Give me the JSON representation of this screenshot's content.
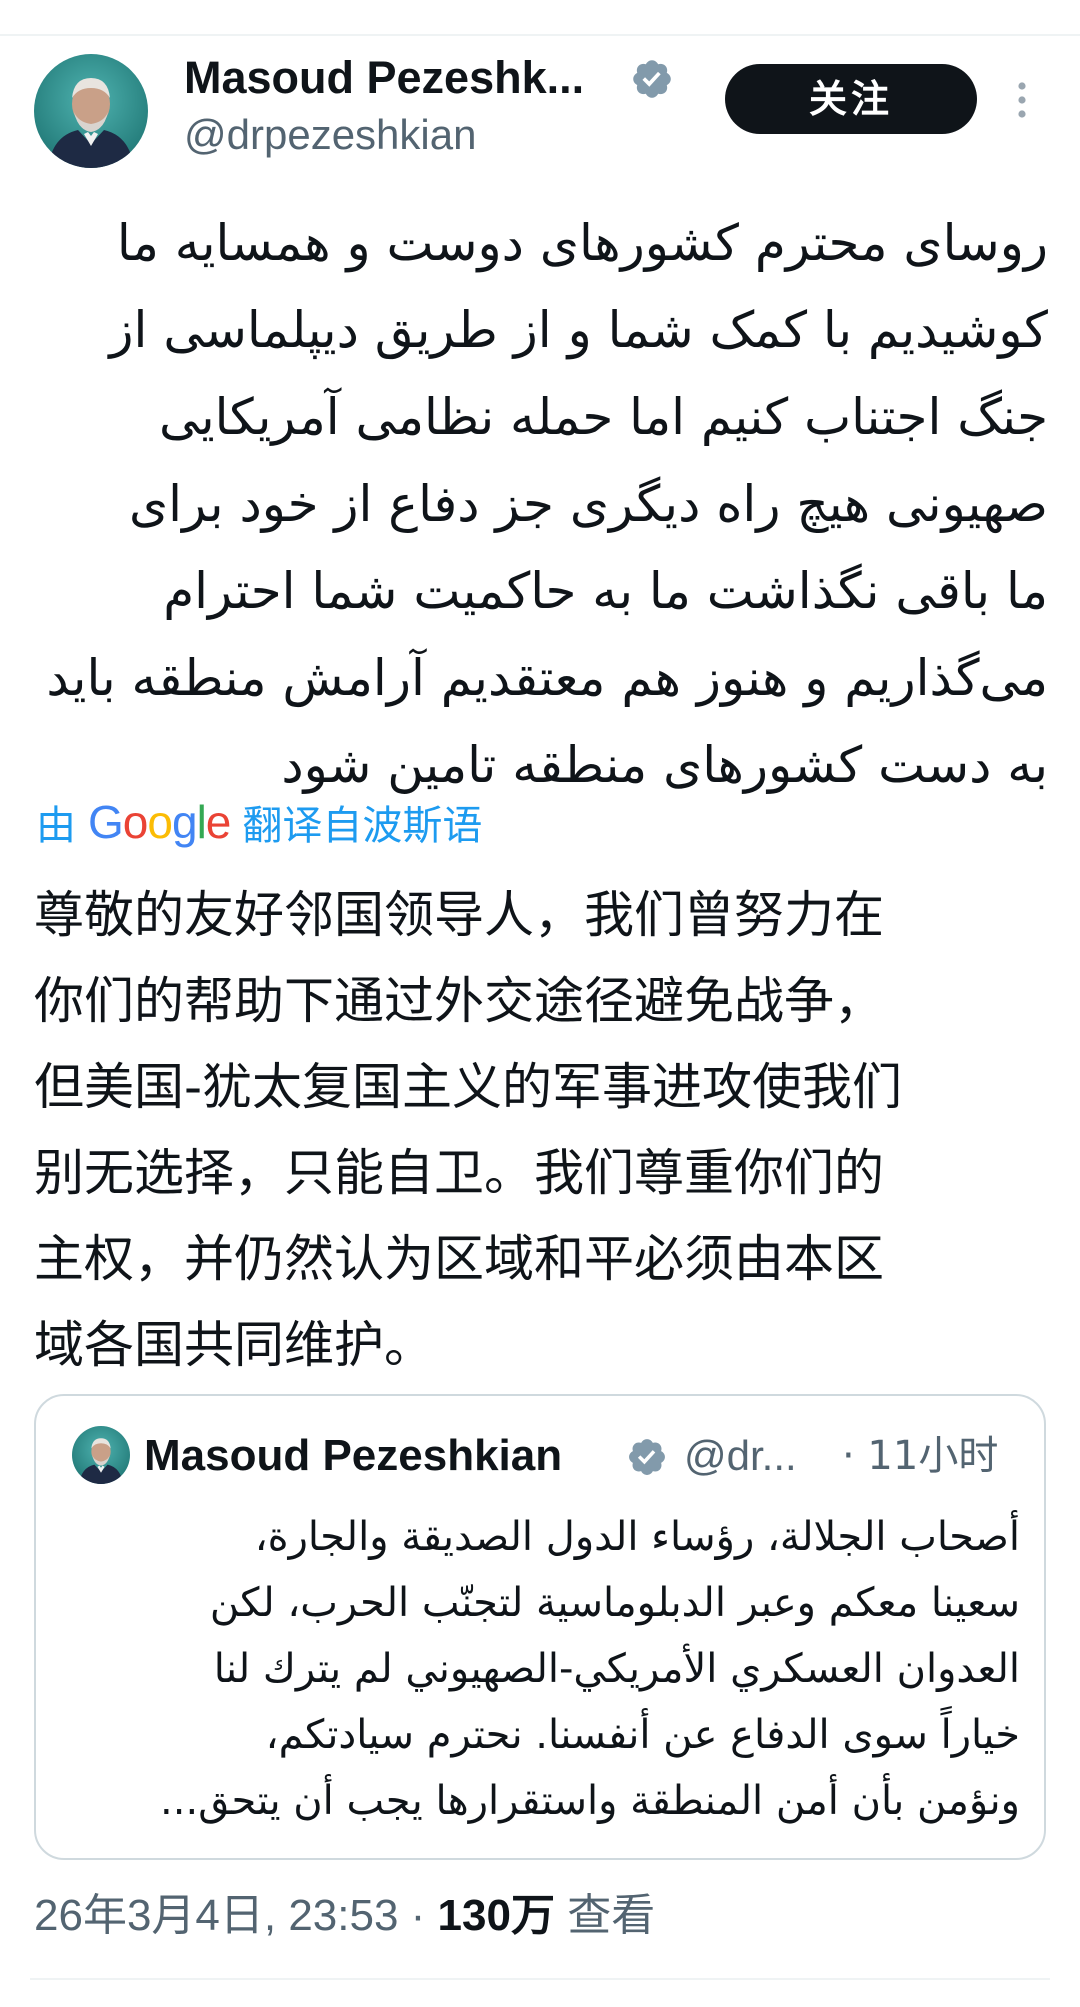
{
  "author": {
    "display_name": "Masoud Pezeshk...",
    "handle": "@drpezeshkian",
    "verified": true
  },
  "follow_label": "关注",
  "more_icon": "more-vertical-icon",
  "tweet": {
    "original_lines": [
      "روسای محترم کشورهای دوست و همسایه ما",
      "کوشیدیم با کمک شما و از طریق دیپلماسی از",
      "جنگ اجتناب کنیم اما حمله نظامی آمریکایی",
      "صهیونی هیچ راه دیگری جز دفاع از خود برای",
      "ما باقی نگذاشت ما به حاکمیت شما احترام",
      "می‌گذاریم و هنوز هم معتقدیم آرامش منطقه باید",
      "به دست کشورهای منطقه تامین شود"
    ],
    "translation_note": {
      "prefix": "由",
      "brand": "Google",
      "link": "翻译自波斯语"
    },
    "translated_lines": [
      "尊敬的友好邻国领导人，我们曾努力在",
      "你们的帮助下通过外交途径避免战争，",
      "但美国-犹太复国主义的军事进攻使我们",
      "别无选择，只能自卫。我们尊重你们的",
      "主权，并仍然认为区域和平必须由本区",
      "域各国共同维护。"
    ]
  },
  "quote": {
    "display_name": "Masoud Pezeshkian",
    "handle": "@dr...",
    "time": "· 11小时",
    "lines": [
      "أصحاب الجلالة، رؤساء الدول الصديقة والجارة،",
      "سعينا معكم وعبر الدبلوماسية لتجنّب الحرب، لكن",
      "العدوان العسكري الأمريكي-الصهيوني لم يترك لنا",
      "خياراً سوى الدفاع عن أنفسنا. نحترم سيادتكم،",
      "ونؤمن بأن أمن المنطقة واستقرارها يجب أن يتحق..."
    ]
  },
  "meta": {
    "timestamp": "26年3月4日, 23:53 · ",
    "views_count": "130万",
    "views_label": " 查看"
  },
  "colors": {
    "text": "#0f1419",
    "secondary": "#536471",
    "link": "#1d9bf0",
    "verified": "#829aab",
    "google_blue": "#4285f4",
    "google_red": "#ea4335",
    "google_yellow": "#fbbc05",
    "google_green": "#34a853"
  }
}
